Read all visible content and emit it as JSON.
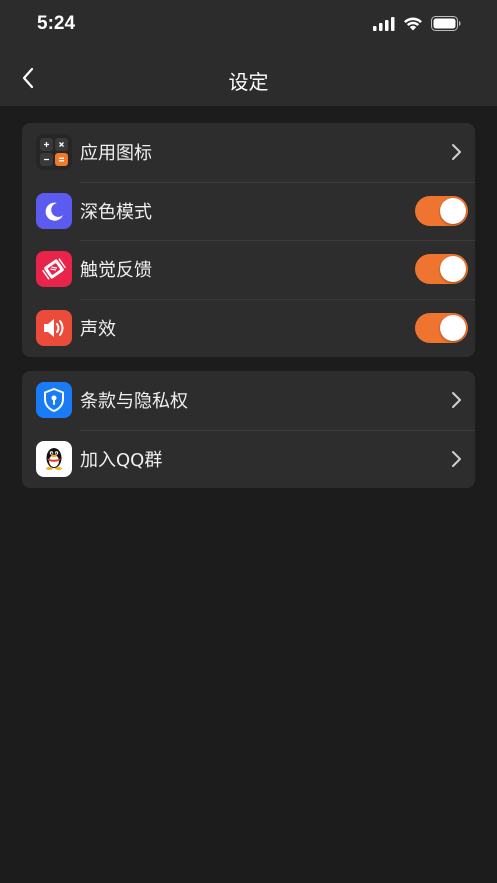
{
  "status_bar": {
    "time": "5:24"
  },
  "nav": {
    "title": "设定"
  },
  "groups": [
    {
      "items": [
        {
          "label": "应用图标",
          "icon": "calculator-icon",
          "accessory": "chevron"
        },
        {
          "label": "深色模式",
          "icon": "moon-icon",
          "accessory": "toggle",
          "on": true
        },
        {
          "label": "触觉反馈",
          "icon": "haptic-icon",
          "accessory": "toggle",
          "on": true
        },
        {
          "label": "声效",
          "icon": "speaker-icon",
          "accessory": "toggle",
          "on": true
        }
      ]
    },
    {
      "items": [
        {
          "label": "条款与隐私权",
          "icon": "privacy-shield-icon",
          "accessory": "chevron"
        },
        {
          "label": "加入QQ群",
          "icon": "qq-penguin-icon",
          "accessory": "chevron"
        }
      ]
    }
  ],
  "colors": {
    "background": "#1c1c1c",
    "header": "#2c2c2c",
    "card": "#2d2d2d",
    "toggle_on": "#ef7430",
    "moon_icon_bg": "#5b5bf0",
    "haptic_icon_bg": "#e8244a",
    "speaker_icon_bg": "#eb4b3b",
    "privacy_icon_bg": "#1a7cf5"
  }
}
